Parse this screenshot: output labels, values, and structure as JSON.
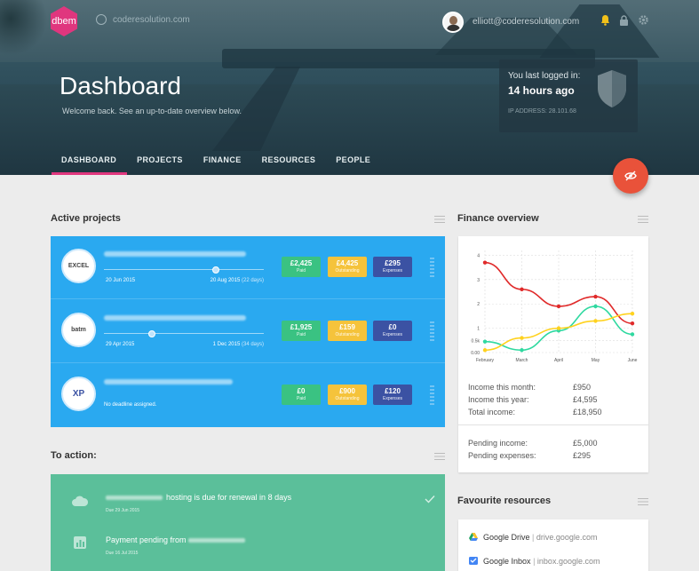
{
  "header": {
    "logo_text": "dbem",
    "site_url": "coderesolution.com",
    "user_email": "elliott@coderesolution.com",
    "title": "Dashboard",
    "subtitle": "Welcome back. See an up-to-date overview below."
  },
  "login_card": {
    "label": "You last logged in:",
    "time": "14 hours ago",
    "ip": "IP ADDRESS: 28.101.68"
  },
  "nav": [
    "DASHBOARD",
    "PROJECTS",
    "FINANCE",
    "RESOURCES",
    "PEOPLE"
  ],
  "nav_active": "DASHBOARD",
  "active_projects": {
    "title": "Active projects",
    "projects": [
      {
        "logo": "EXCEL",
        "start": "20 Jun 2015",
        "end": "20 Aug 2015",
        "remaining": "(22 days)",
        "progress": 0.7,
        "paid": "£2,425",
        "paid_label": "Paid",
        "outstanding": "£4,425",
        "outstanding_label": "Outstanding",
        "expenses": "£295",
        "expenses_label": "Expenses"
      },
      {
        "logo": "batm",
        "start": "29 Apr 2015",
        "end": "1 Dec 2015",
        "remaining": "(34 days)",
        "progress": 0.3,
        "paid": "£1,925",
        "paid_label": "Paid",
        "outstanding": "£159",
        "outstanding_label": "Outstanding",
        "expenses": "£0",
        "expenses_label": "Expenses"
      },
      {
        "logo": "XP",
        "no_deadline": "No deadline assigned.",
        "paid": "£0",
        "paid_label": "Paid",
        "outstanding": "£900",
        "outstanding_label": "Outstanding",
        "expenses": "£120",
        "expenses_label": "Expenses"
      }
    ]
  },
  "to_action": {
    "title": "To action:",
    "items": [
      {
        "text": "hosting is due for renewal in 8 days",
        "due": "Due 29 Jun 2015"
      },
      {
        "text": "Payment pending from",
        "due": "Due 16 Jul 2015"
      }
    ]
  },
  "finance": {
    "title": "Finance overview",
    "income_month_label": "Income this month:",
    "income_month": "£950",
    "income_year_label": "Income this year:",
    "income_year": "£4,595",
    "total_income_label": "Total income:",
    "total_income": "£18,950",
    "pending_income_label": "Pending income:",
    "pending_income": "£5,000",
    "pending_expenses_label": "Pending expenses:",
    "pending_expenses": "£295"
  },
  "chart_data": {
    "type": "line",
    "categories": [
      "February",
      "March",
      "April",
      "May",
      "June"
    ],
    "y_ticks": [
      "0.00",
      "0.5k",
      "1",
      "2",
      "3",
      "4"
    ],
    "ylim": [
      0,
      4.2
    ],
    "grid": true,
    "series": [
      {
        "color": "#e02a2a",
        "values": [
          3.7,
          2.6,
          1.9,
          2.3,
          1.2
        ]
      },
      {
        "color": "#2fd9a0",
        "values": [
          0.45,
          0.1,
          0.9,
          1.9,
          0.75
        ]
      },
      {
        "color": "#ffd21e",
        "values": [
          0.1,
          0.6,
          1.0,
          1.3,
          1.6
        ]
      }
    ]
  },
  "resources": {
    "title": "Favourite resources",
    "items": [
      {
        "name": "Google Drive",
        "domain": "drive.google.com"
      },
      {
        "name": "Google Inbox",
        "domain": "inbox.google.com"
      }
    ]
  },
  "colors": {
    "accent": "#e0367e",
    "projects_bg": "#2aa9f0",
    "action_bg": "#5bbf9a",
    "fab": "#e9523a",
    "paid": "#3ac282",
    "outstanding": "#f5c33b",
    "expenses": "#3b52a3"
  },
  "icons": [
    "globe-icon",
    "bell-icon",
    "lock-icon",
    "gear-icon",
    "shield-icon",
    "hide-icon",
    "cloud-icon",
    "chart-icon",
    "check-icon",
    "google-drive-icon",
    "google-inbox-icon"
  ]
}
